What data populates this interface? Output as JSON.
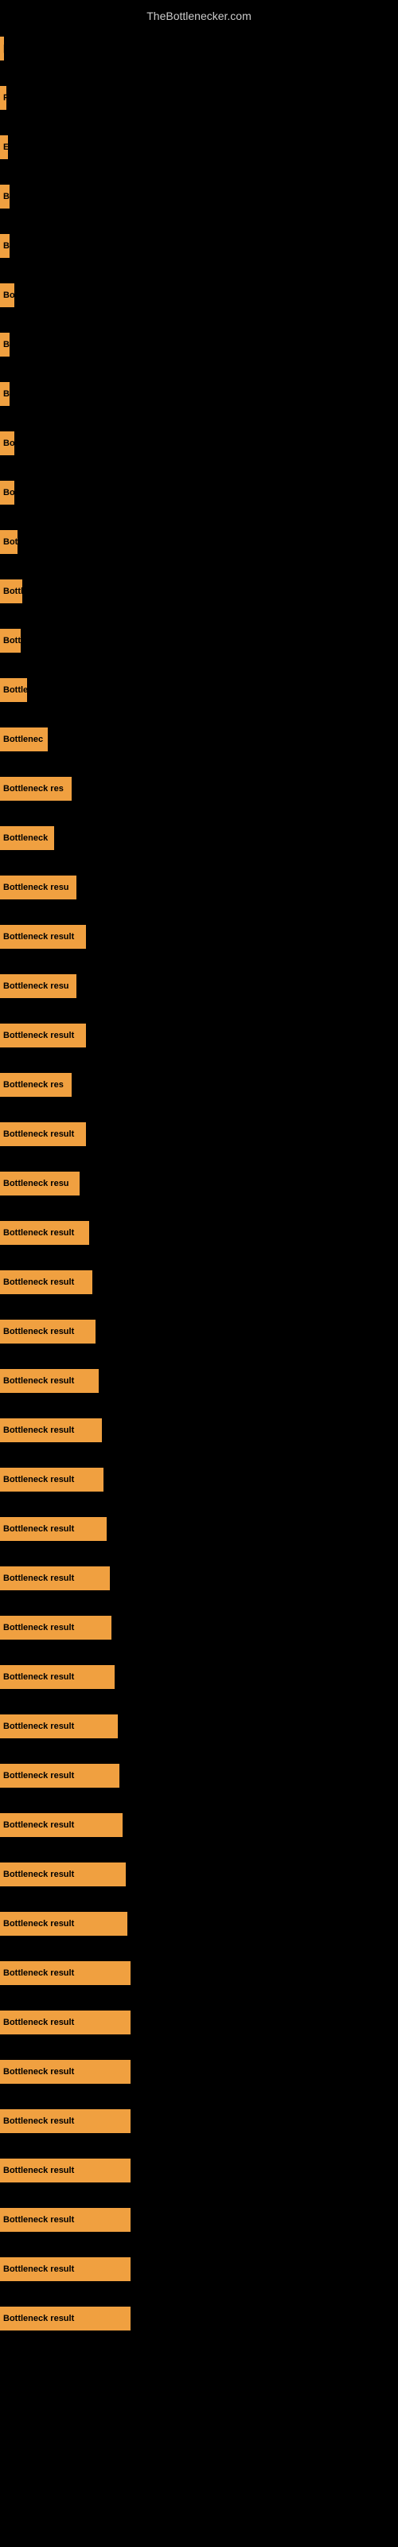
{
  "site": {
    "title": "TheBottlenecker.com"
  },
  "bars": [
    {
      "label": "|",
      "width": 5
    },
    {
      "label": "P",
      "width": 8
    },
    {
      "label": "E",
      "width": 10
    },
    {
      "label": "B",
      "width": 12
    },
    {
      "label": "B",
      "width": 12
    },
    {
      "label": "Bo",
      "width": 18
    },
    {
      "label": "B",
      "width": 12
    },
    {
      "label": "B",
      "width": 12
    },
    {
      "label": "Bo",
      "width": 18
    },
    {
      "label": "Bo",
      "width": 18
    },
    {
      "label": "Bot",
      "width": 22
    },
    {
      "label": "Bottl",
      "width": 28
    },
    {
      "label": "Bott",
      "width": 26
    },
    {
      "label": "Bottle",
      "width": 34
    },
    {
      "label": "Bottlenec",
      "width": 60
    },
    {
      "label": "Bottleneck res",
      "width": 90
    },
    {
      "label": "Bottleneck",
      "width": 68
    },
    {
      "label": "Bottleneck resu",
      "width": 96
    },
    {
      "label": "Bottleneck result",
      "width": 108
    },
    {
      "label": "Bottleneck resu",
      "width": 96
    },
    {
      "label": "Bottleneck result",
      "width": 108
    },
    {
      "label": "Bottleneck res",
      "width": 90
    },
    {
      "label": "Bottleneck result",
      "width": 108
    },
    {
      "label": "Bottleneck resu",
      "width": 100
    },
    {
      "label": "Bottleneck result",
      "width": 112
    },
    {
      "label": "Bottleneck result",
      "width": 116
    },
    {
      "label": "Bottleneck result",
      "width": 120
    },
    {
      "label": "Bottleneck result",
      "width": 124
    },
    {
      "label": "Bottleneck result",
      "width": 128
    },
    {
      "label": "Bottleneck result",
      "width": 130
    },
    {
      "label": "Bottleneck result",
      "width": 134
    },
    {
      "label": "Bottleneck result",
      "width": 138
    },
    {
      "label": "Bottleneck result",
      "width": 140
    },
    {
      "label": "Bottleneck result",
      "width": 144
    },
    {
      "label": "Bottleneck result",
      "width": 148
    },
    {
      "label": "Bottleneck result",
      "width": 150
    },
    {
      "label": "Bottleneck result",
      "width": 154
    },
    {
      "label": "Bottleneck result",
      "width": 158
    },
    {
      "label": "Bottleneck result",
      "width": 160
    },
    {
      "label": "Bottleneck result",
      "width": 164
    },
    {
      "label": "Bottleneck result",
      "width": 164
    },
    {
      "label": "Bottleneck result",
      "width": 164
    },
    {
      "label": "Bottleneck result",
      "width": 164
    },
    {
      "label": "Bottleneck result",
      "width": 164
    },
    {
      "label": "Bottleneck result",
      "width": 164
    },
    {
      "label": "Bottleneck result",
      "width": 164
    },
    {
      "label": "Bottleneck result",
      "width": 164
    }
  ]
}
